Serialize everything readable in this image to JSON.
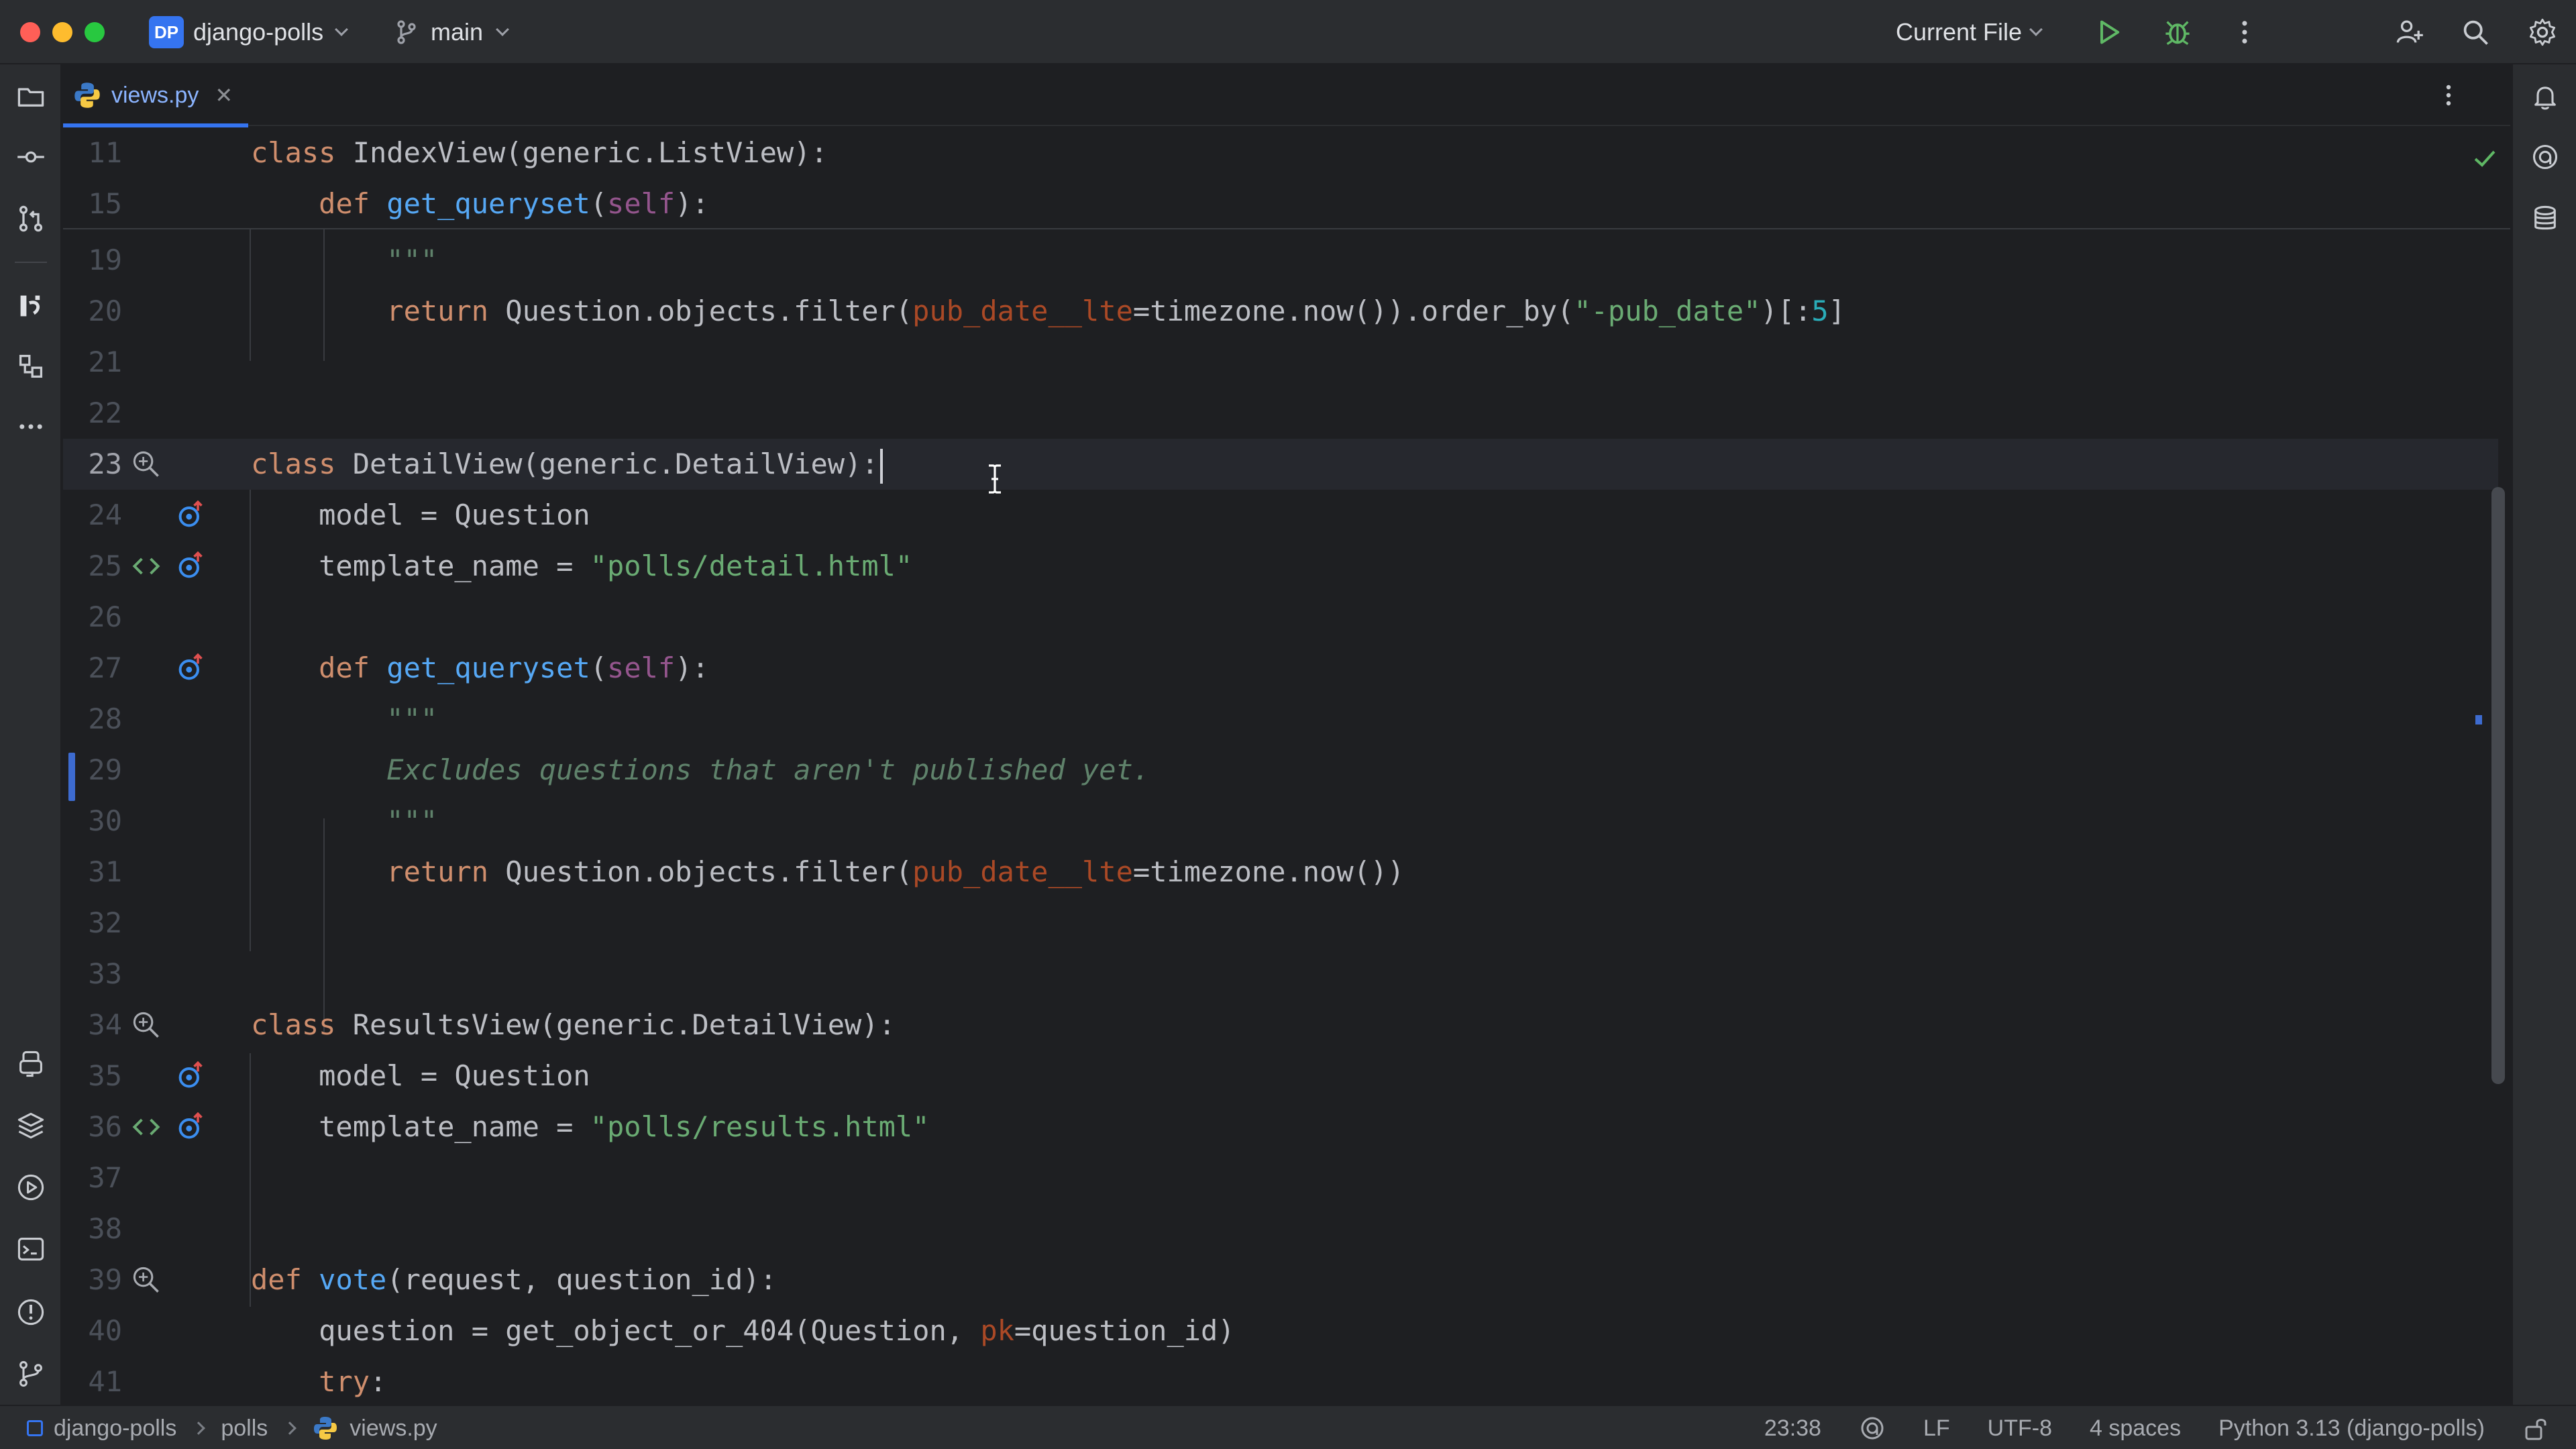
{
  "titlebar": {
    "project_badge": "DP",
    "project_name": "django-polls",
    "branch": "main",
    "run_config": "Current File"
  },
  "tabs": [
    {
      "label": "views.py",
      "icon": "python-file-icon",
      "active": true
    }
  ],
  "editor": {
    "sticky_lines": [
      {
        "num": "11",
        "code": "class IndexView(generic.ListView):"
      },
      {
        "num": "15",
        "code": "    def get_queryset(self):"
      }
    ],
    "lines": [
      {
        "num": "19",
        "code": "        \"\"\""
      },
      {
        "num": "20",
        "code": "        return Question.objects.filter(pub_date__lte=timezone.now()).order_by(\"-pub_date\")[:5]"
      },
      {
        "num": "21",
        "code": ""
      },
      {
        "num": "22",
        "code": ""
      },
      {
        "num": "23",
        "code": "class DetailView(generic.DetailView):",
        "current": true
      },
      {
        "num": "24",
        "code": "    model = Question"
      },
      {
        "num": "25",
        "code": "    template_name = \"polls/detail.html\""
      },
      {
        "num": "26",
        "code": ""
      },
      {
        "num": "27",
        "code": "    def get_queryset(self):"
      },
      {
        "num": "28",
        "code": "        \"\"\""
      },
      {
        "num": "29",
        "code": "        Excludes questions that aren't published yet."
      },
      {
        "num": "30",
        "code": "        \"\"\""
      },
      {
        "num": "31",
        "code": "        return Question.objects.filter(pub_date__lte=timezone.now())"
      },
      {
        "num": "32",
        "code": ""
      },
      {
        "num": "33",
        "code": ""
      },
      {
        "num": "34",
        "code": "class ResultsView(generic.DetailView):"
      },
      {
        "num": "35",
        "code": "    model = Question"
      },
      {
        "num": "36",
        "code": "    template_name = \"polls/results.html\""
      },
      {
        "num": "37",
        "code": ""
      },
      {
        "num": "38",
        "code": ""
      },
      {
        "num": "39",
        "code": "def vote(request, question_id):"
      },
      {
        "num": "40",
        "code": "    question = get_object_or_404(Question, pk=question_id)"
      },
      {
        "num": "41",
        "code": "    try:"
      }
    ]
  },
  "statusbar": {
    "breadcrumbs": [
      "django-polls",
      "polls",
      "views.py"
    ],
    "cursor_position": "23:38",
    "line_separator": "LF",
    "encoding": "UTF-8",
    "indent": "4 spaces",
    "interpreter": "Python 3.13 (django-polls)"
  },
  "colors": {
    "accent": "#3574f0",
    "keyword": "#cf8e6d",
    "function": "#56a8f5",
    "string": "#6aab73",
    "docstring": "#5f826b",
    "self": "#94558d",
    "number": "#2aacb8",
    "keyword_arg": "#aa4926"
  }
}
